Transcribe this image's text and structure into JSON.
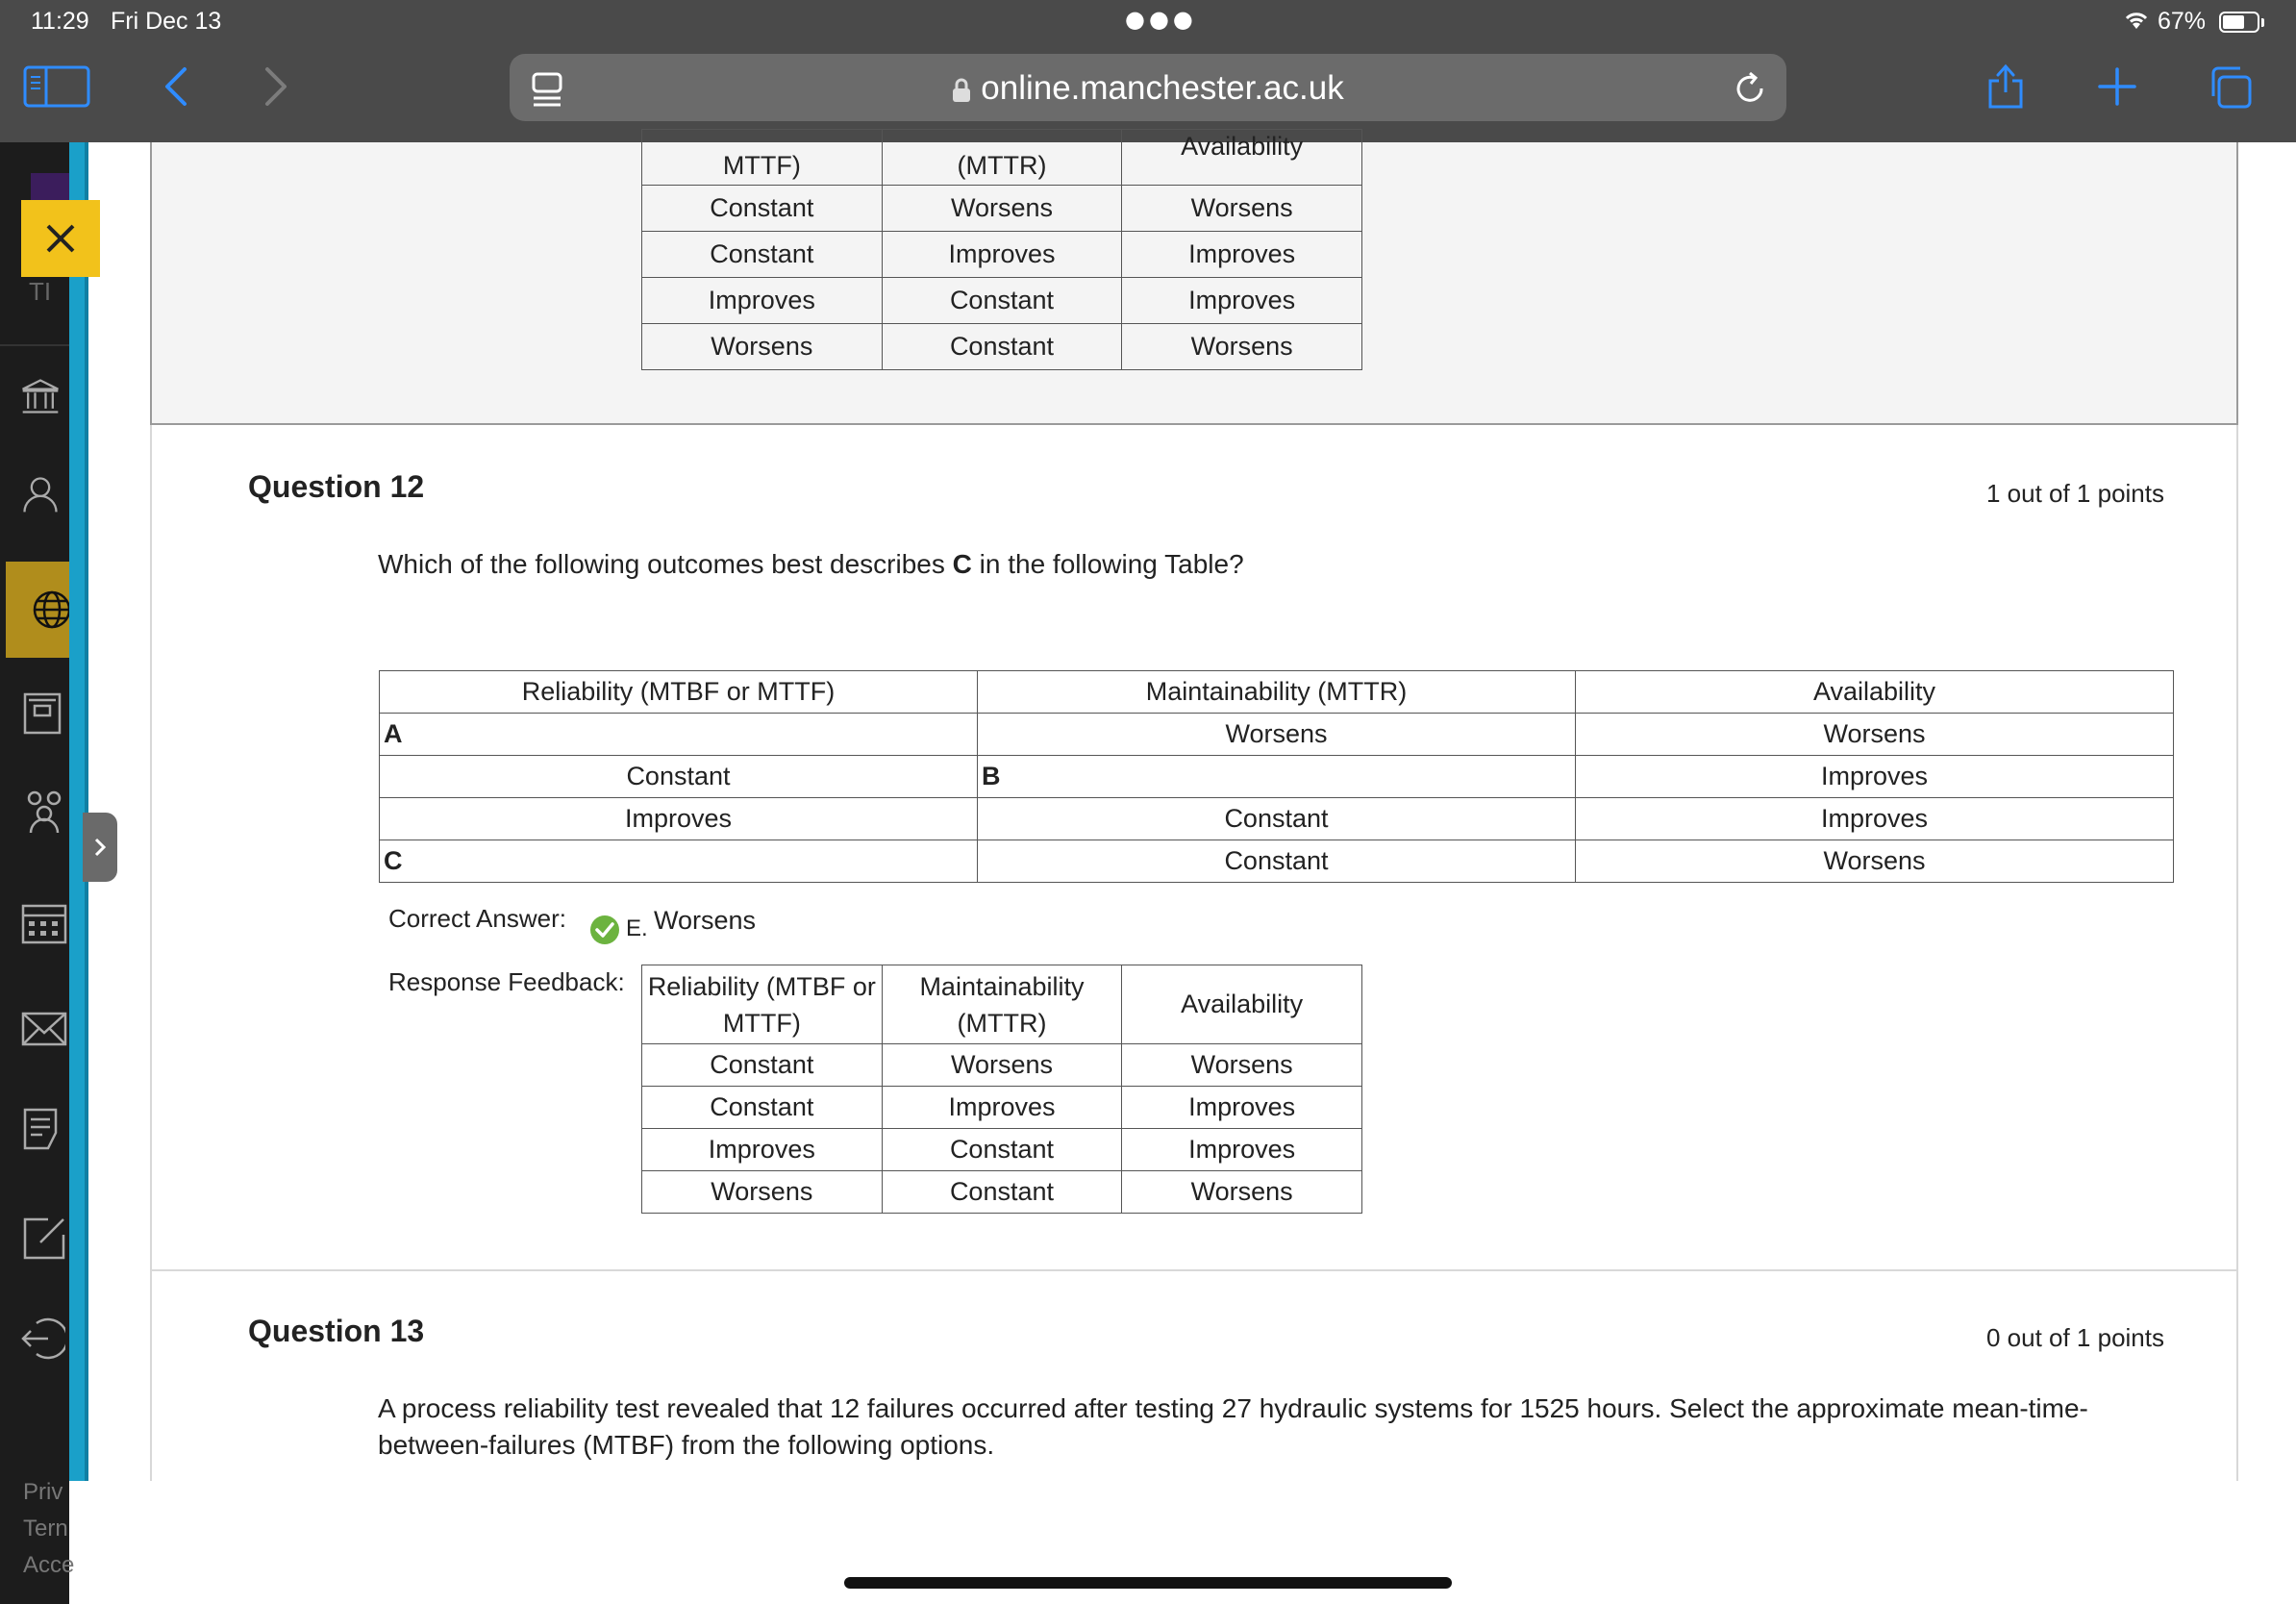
{
  "status": {
    "time": "11:29",
    "date": "Fri Dec 13",
    "battery": "67%"
  },
  "browser": {
    "url": "online.manchester.ac.uk"
  },
  "sidebar": {
    "footer": [
      "Priv",
      "Tern",
      "Acce"
    ],
    "truncated_label": "TI"
  },
  "prev_table": {
    "header_partial": [
      "MTTF)",
      "(MTTR)",
      "Availability"
    ],
    "rows": [
      [
        "Constant",
        "Worsens",
        "Worsens"
      ],
      [
        "Constant",
        "Improves",
        "Improves"
      ],
      [
        "Improves",
        "Constant",
        "Improves"
      ],
      [
        "Worsens",
        "Constant",
        "Worsens"
      ]
    ]
  },
  "q12": {
    "title": "Question 12",
    "points": "1 out of 1 points",
    "text_before": "Which of the following outcomes best describes ",
    "text_bold": "C",
    "text_after": " in the following Table?",
    "table": {
      "headers": [
        "Reliability (MTBF or MTTF)",
        "Maintainability (MTTR)",
        "Availability"
      ],
      "rows": [
        [
          "A",
          "Worsens",
          "Worsens"
        ],
        [
          "Constant",
          "B",
          "Improves"
        ],
        [
          "Improves",
          "Constant",
          "Improves"
        ],
        [
          "C",
          "Constant",
          "Worsens"
        ]
      ]
    },
    "correct_label": "Correct Answer:",
    "correct_letter": "E.",
    "correct_value": "Worsens",
    "feedback_label": "Response Feedback:",
    "feedback_table": {
      "headers": [
        "Reliability (MTBF or MTTF)",
        "Maintainability (MTTR)",
        "Availability"
      ],
      "rows": [
        [
          "Constant",
          "Worsens",
          "Worsens"
        ],
        [
          "Constant",
          "Improves",
          "Improves"
        ],
        [
          "Improves",
          "Constant",
          "Improves"
        ],
        [
          "Worsens",
          "Constant",
          "Worsens"
        ]
      ]
    }
  },
  "q13": {
    "title": "Question 13",
    "points": "0 out of 1 points",
    "text_line1": "A process reliability test revealed that 12 failures occurred after testing 27 hydraulic systems for 1525 hours. Select the approximate mean-time-",
    "text_line2": "between-failures (MTBF) from the following options."
  },
  "colors": {
    "chrome": "#4a4a4a",
    "accent_blue": "#1aa0c9",
    "close_yellow": "#f2c21b",
    "active_gold": "#b08d1c",
    "check_green": "#6cb33f",
    "safari_blue": "#2f8cff"
  }
}
